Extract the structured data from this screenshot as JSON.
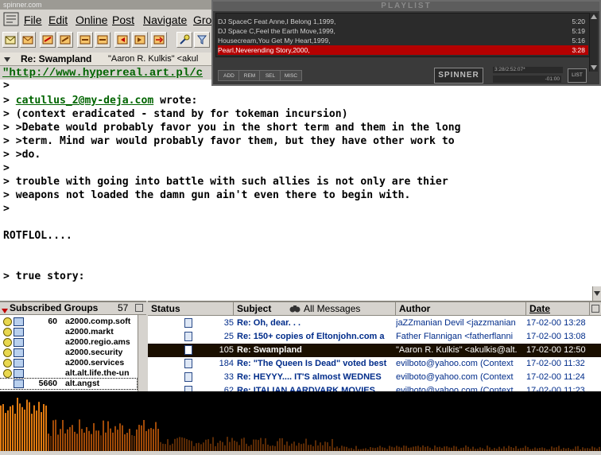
{
  "reader": {
    "window_title": "spinner.com",
    "menu": [
      "File",
      "Edit",
      "Online",
      "Post",
      "Navigate",
      "Gro"
    ],
    "header": {
      "subject": "Re: Swampland",
      "from": "\"Aaron R. Kulkis\" <akul"
    },
    "url": "\"http://www.hyperreal.art.pl/c",
    "body_lines": [
      ">",
      "> catullus_2@my-deja.com wrote:",
      "> (context eradicated - stand by for tokeman incursion)",
      "> >Debate would probably favor you in the short term and them in the long",
      "> >term. Mind war would probably favor them, but they have other work to",
      "> >do.",
      ">",
      "> trouble with going into battle with such allies is not only are thier",
      "> weapons not loaded the damn gun ain't even there to begin with.",
      ">",
      "",
      "ROTFLOL....",
      "",
      "",
      "> true story:"
    ],
    "link_text": "catullus_2@my-deja.com"
  },
  "groups": {
    "header_label": "Subscribed Groups",
    "header_count": "57",
    "items": [
      {
        "count": "60",
        "name": "a2000.comp.soft"
      },
      {
        "count": "",
        "name": "a2000.markt"
      },
      {
        "count": "",
        "name": "a2000.regio.ams"
      },
      {
        "count": "",
        "name": "a2000.security"
      },
      {
        "count": "",
        "name": "a2000.services"
      },
      {
        "count": "",
        "name": "alt.alt.life.the-un"
      },
      {
        "count": "5660",
        "name": "alt.angst"
      }
    ]
  },
  "msglist": {
    "columns": {
      "status": "Status",
      "subject": "Subject",
      "filter": "All Messages",
      "author": "Author",
      "date": "Date"
    },
    "rows": [
      {
        "num": "35",
        "subject": "Re: Oh, dear. . .",
        "author": "jaZZmanian Devil <jazzmanian",
        "date": "17-02-00 13:28",
        "selected": false
      },
      {
        "num": "25",
        "subject": "Re: 150+ copies of Eltonjohn.com a",
        "author": "Father Flannigan <fatherflanni",
        "date": "17-02-00 13:08",
        "selected": false
      },
      {
        "num": "105",
        "subject": "Re: Swampland",
        "author": "\"Aaron R. Kulkis\" <akulkis@alt.",
        "date": "17-02-00 12:50",
        "selected": true
      },
      {
        "num": "184",
        "subject": "Re: \"The Queen Is Dead\" voted best",
        "author": "evilboto@yahoo.com (Context",
        "date": "17-02-00 11:32",
        "selected": false
      },
      {
        "num": "33",
        "subject": "Re: HEYYY.... IT'S almost WEDNES",
        "author": "evilboto@yahoo.com (Context",
        "date": "17-02-00 11:24",
        "selected": false
      },
      {
        "num": "62",
        "subject": "Re: ITALIAN AARDVARK MOVIES",
        "author": "evilboto@yahoo.com (Context",
        "date": "17-02-00 11:23",
        "selected": false
      }
    ]
  },
  "playlist": {
    "title": "PLAYLIST",
    "tracks": [
      {
        "name": "DJ SpaceC Feat Anne,I Belong 1,1999,",
        "time": "5:20",
        "active": false
      },
      {
        "name": "DJ Space C,Feel the Earth Move,1999,",
        "time": "5:19",
        "active": false
      },
      {
        "name": "Housecream,You Get My Heart,1999,",
        "time": "5:16",
        "active": false
      },
      {
        "name": "Pearl,Neverending Story,2000,",
        "time": "3:28",
        "active": true
      }
    ],
    "buttons": [
      "ADD",
      "REM",
      "SEL",
      "MISC"
    ],
    "logo": "SPINNER",
    "lcd_top": "3:28/2:52:07*",
    "lcd_bottom": "-01:00",
    "list_button": "LIST"
  },
  "colors": {
    "selection": "#1a0f00",
    "active_track": "#b40000",
    "link": "#006400"
  }
}
